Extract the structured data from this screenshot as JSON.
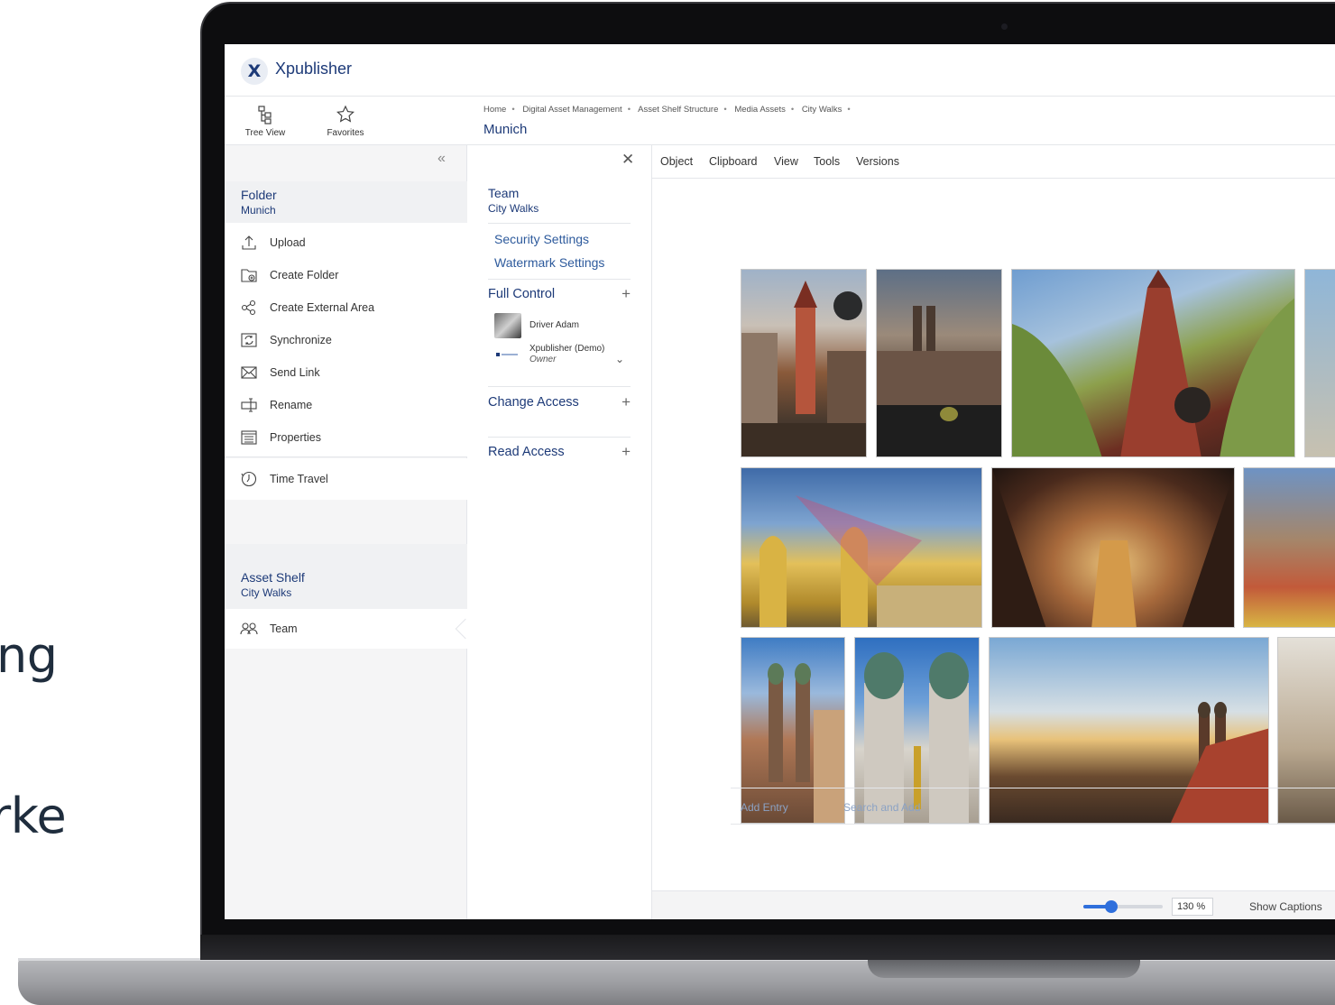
{
  "background_text": [
    "ng",
    "rke"
  ],
  "app": {
    "logo_glyph": "X",
    "name": "Xpublisher"
  },
  "left_panel": {
    "tabs": [
      {
        "label": "Tree View",
        "icon": "tree-view-icon"
      },
      {
        "label": "Favorites",
        "icon": "star-icon"
      }
    ],
    "collapse_glyph": "«",
    "folder": {
      "title": "Folder",
      "subtitle": "Munich"
    },
    "actions": [
      {
        "label": "Upload",
        "icon": "upload-icon"
      },
      {
        "label": "Create Folder",
        "icon": "create-folder-icon"
      },
      {
        "label": "Create External Area",
        "icon": "share-icon"
      },
      {
        "label": "Synchronize",
        "icon": "sync-icon"
      },
      {
        "label": "Send Link",
        "icon": "envelope-icon"
      },
      {
        "label": "Rename",
        "icon": "rename-icon"
      },
      {
        "label": "Properties",
        "icon": "properties-icon"
      }
    ],
    "time_travel": {
      "label": "Time Travel",
      "icon": "clock-icon"
    },
    "asset_shelf": {
      "title": "Asset Shelf",
      "subtitle": "City Walks"
    },
    "team": {
      "label": "Team",
      "icon": "team-icon"
    }
  },
  "breadcrumb": {
    "items": [
      "Home",
      "Digital Asset Management",
      "Asset Shelf Structure",
      "Media Assets",
      "City Walks"
    ],
    "separator": "•",
    "title": "Munich"
  },
  "team_panel": {
    "close_glyph": "✕",
    "title": "Team",
    "subtitle": "City Walks",
    "links": [
      "Security Settings",
      "Watermark Settings"
    ],
    "sections": [
      {
        "title": "Full Control",
        "icon": "plus-icon"
      },
      {
        "title": "Change Access",
        "icon": "plus-icon"
      },
      {
        "title": "Read Access",
        "icon": "plus-icon"
      }
    ],
    "plus_glyph": "+",
    "members": [
      {
        "name": "Driver Adam",
        "role": ""
      },
      {
        "name": "Xpublisher (Demo)",
        "role": "Owner"
      }
    ],
    "chevron_glyph": "⌄"
  },
  "content": {
    "toolbar": [
      "Object",
      "Clipboard",
      "View",
      "Tools",
      "Versions"
    ],
    "add_entry": "Add Entry",
    "search_add": "Search and Add",
    "zoom_label": "130 %",
    "zoom_fraction": 0.35,
    "show_captions": "Show Captions"
  },
  "colors": {
    "brand": "#1d3a78",
    "link": "#2d5a9c",
    "accent": "#2f6fdc"
  }
}
